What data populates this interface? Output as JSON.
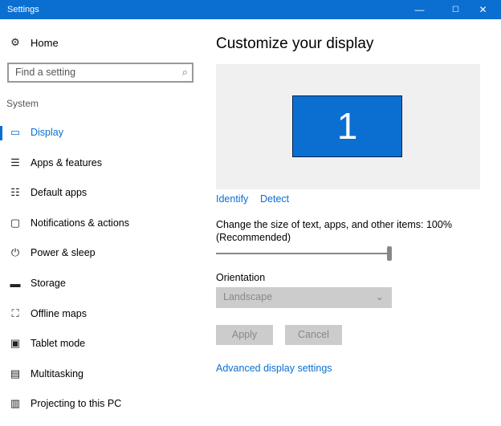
{
  "window": {
    "title": "Settings",
    "minimize": "—",
    "maximize": "☐",
    "close": "✕"
  },
  "sidebar": {
    "home": "Home",
    "search_placeholder": "Find a setting",
    "section": "System",
    "items": [
      {
        "label": "Display",
        "icon": "▭"
      },
      {
        "label": "Apps & features",
        "icon": "☰"
      },
      {
        "label": "Default apps",
        "icon": "☷"
      },
      {
        "label": "Notifications & actions",
        "icon": "▢"
      },
      {
        "label": "Power & sleep",
        "icon": "⏻"
      },
      {
        "label": "Storage",
        "icon": "▬"
      },
      {
        "label": "Offline maps",
        "icon": "⛶"
      },
      {
        "label": "Tablet mode",
        "icon": "▣"
      },
      {
        "label": "Multitasking",
        "icon": "▤"
      },
      {
        "label": "Projecting to this PC",
        "icon": "▥"
      }
    ]
  },
  "main": {
    "title": "Customize your display",
    "monitor": "1",
    "identify": "Identify",
    "detect": "Detect",
    "scale_label": "Change the size of text, apps, and other items: 100%",
    "scale_label2": "(Recommended)",
    "scale_value": 1.0,
    "orientation_label": "Orientation",
    "orientation_value": "Landscape",
    "apply": "Apply",
    "cancel": "Cancel",
    "advanced": "Advanced display settings"
  },
  "colors": {
    "accent": "#0a6fd1"
  }
}
